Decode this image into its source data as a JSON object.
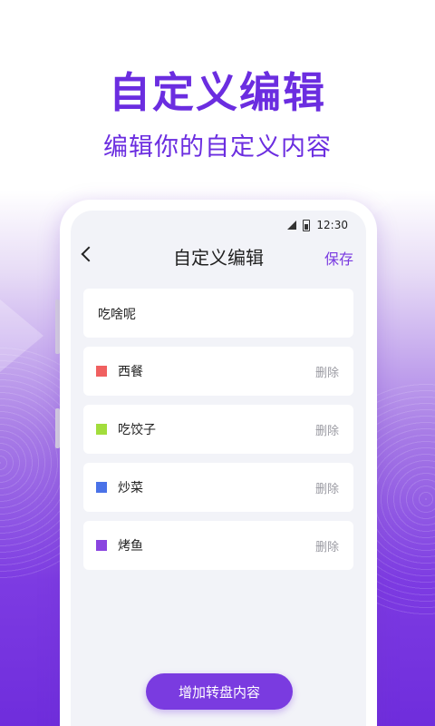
{
  "promo": {
    "headline": "自定义编辑",
    "subheadline": "编辑你的自定义内容"
  },
  "status_bar": {
    "time": "12:30"
  },
  "nav": {
    "title": "自定义编辑",
    "save_label": "保存"
  },
  "input": {
    "value": "吃啥呢"
  },
  "items": [
    {
      "label": "西餐",
      "color": "#f06060",
      "delete_label": "删除"
    },
    {
      "label": "吃饺子",
      "color": "#a2dd3c",
      "delete_label": "删除"
    },
    {
      "label": "炒菜",
      "color": "#4a72e8",
      "delete_label": "删除"
    },
    {
      "label": "烤鱼",
      "color": "#8a45e0",
      "delete_label": "删除"
    }
  ],
  "add_button": {
    "label": "增加转盘内容"
  }
}
